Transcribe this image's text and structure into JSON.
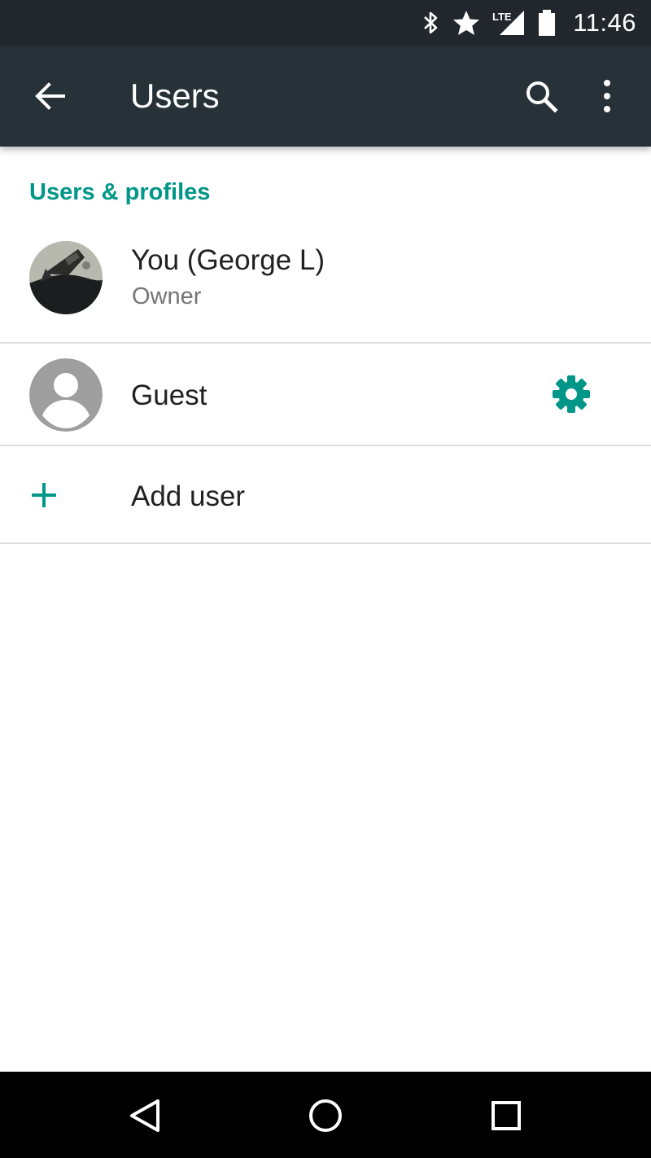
{
  "status_bar": {
    "network_label": "LTE",
    "time": "11:46",
    "icons": [
      "bluetooth-icon",
      "star-icon",
      "lte-signal-icon",
      "battery-icon"
    ]
  },
  "toolbar": {
    "title": "Users",
    "icons": [
      "back-arrow-icon",
      "search-icon",
      "more-vert-icon"
    ]
  },
  "content": {
    "section_title": "Users & profiles",
    "users": [
      {
        "name": "You (George L)",
        "role": "Owner"
      },
      {
        "name": "Guest"
      }
    ],
    "add_user_label": "Add user"
  },
  "nav_bar": {
    "icons": [
      "back-nav-icon",
      "home-nav-icon",
      "recents-nav-icon"
    ]
  },
  "colors": {
    "status_bar_bg": "#21272c",
    "toolbar_bg": "#263238",
    "accent": "#009688",
    "primary_text": "#212121",
    "secondary_text": "#757575",
    "divider": "#dedede"
  }
}
